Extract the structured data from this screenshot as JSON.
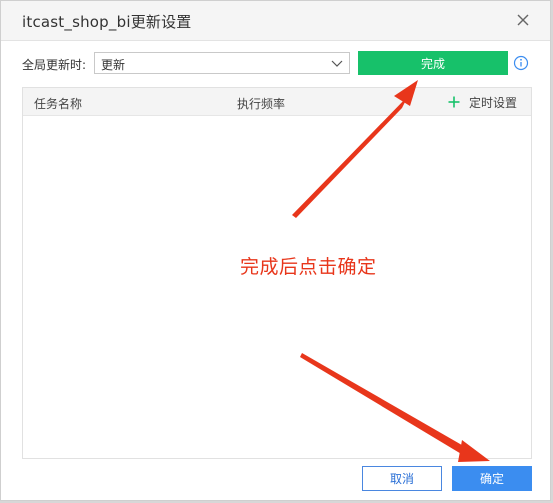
{
  "dialog": {
    "title": "itcast_shop_bi更新设置",
    "close_icon": "close-icon"
  },
  "global_update": {
    "label": "全局更新时:",
    "selected_value": "更新",
    "done_button": "完成",
    "info_icon": "info-icon"
  },
  "task_table": {
    "columns": [
      "任务名称",
      "执行频率"
    ],
    "schedule_label": "定时设置",
    "rows": []
  },
  "annotation": {
    "text": "完成后点击确定",
    "color": "#e8361b"
  },
  "footer": {
    "cancel_label": "取消",
    "ok_label": "确定"
  },
  "colors": {
    "done_green": "#17c16a",
    "primary_blue": "#3b8df0",
    "plus_green": "#17c16a"
  }
}
